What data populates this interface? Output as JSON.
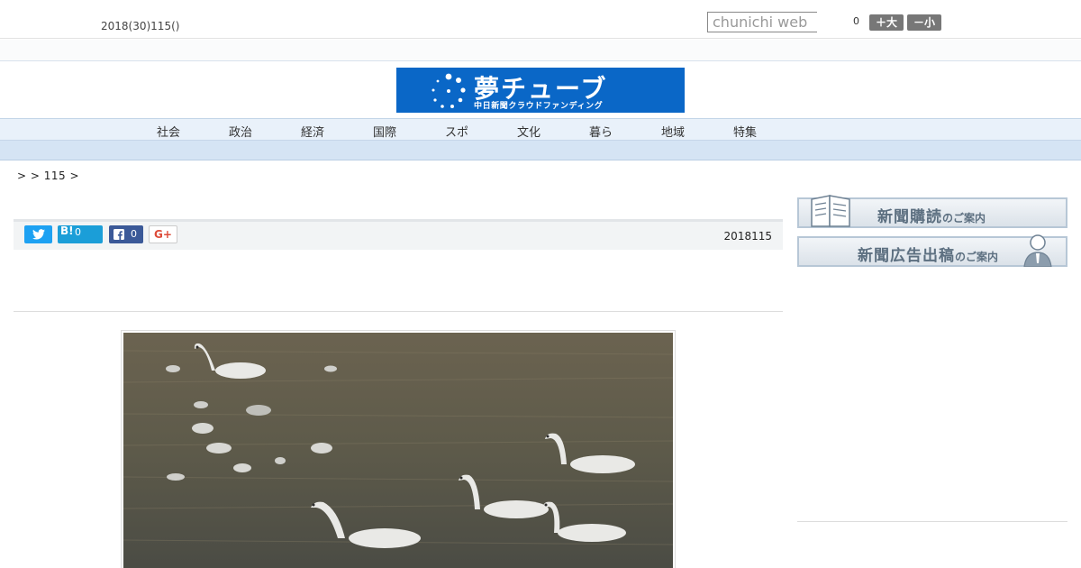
{
  "header": {
    "date_line": "2018(30)115()",
    "search_placeholder": "chunichi web",
    "font_size_value": "0",
    "larger_label": "＋大",
    "smaller_label": "－小"
  },
  "banner": {
    "title": "夢チューブ",
    "subtitle": "中日新聞クラウドファンディング",
    "brand_color": "#0a67c7"
  },
  "nav": {
    "items": [
      "社会",
      "政治",
      "経済",
      "国際",
      "スポ",
      "文化",
      "暮ら",
      "地域",
      "特集"
    ]
  },
  "breadcrumb": ">  > 115 >",
  "share": {
    "hatena_label": "B!",
    "hatena_count": "0",
    "facebook_count": "0",
    "gplus_label": "G+",
    "article_date": "2018115"
  },
  "sidebar": {
    "subscribe_main": "新聞購読",
    "subscribe_small": "のご案内",
    "ad_main": "新聞広告出稿",
    "ad_small": "のご案内"
  },
  "icons": {
    "search": "search-input",
    "twitter": "twitter-icon",
    "facebook": "facebook-icon",
    "book": "book-icon",
    "person": "person-icon"
  }
}
